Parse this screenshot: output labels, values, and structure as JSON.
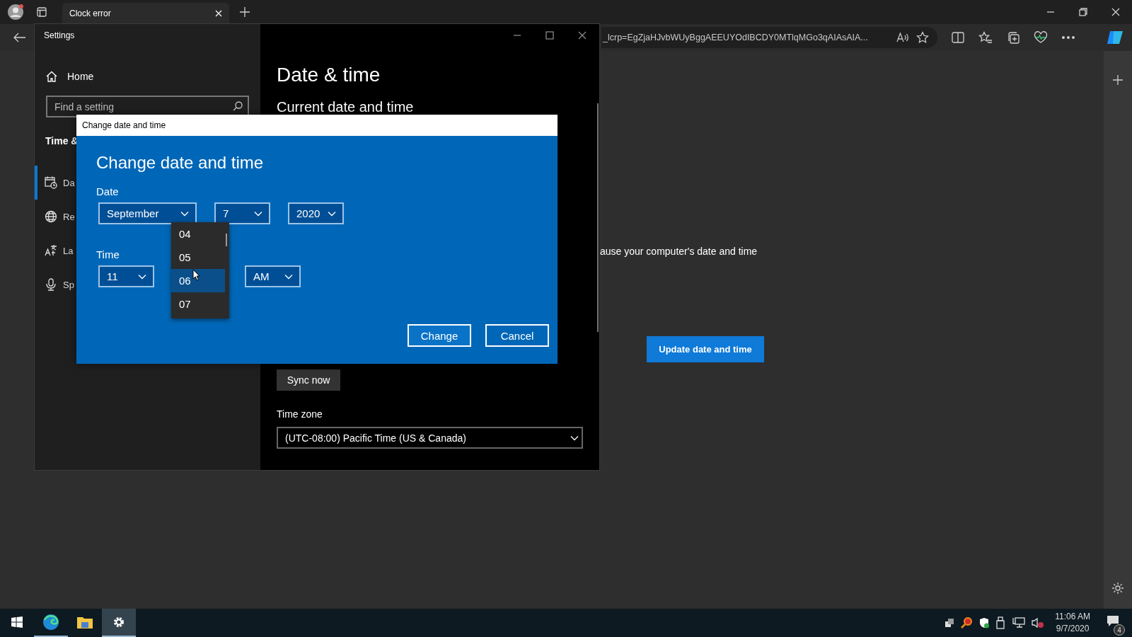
{
  "browser": {
    "tab": {
      "title": "Clock error"
    },
    "address": "_lcrp=EgZjaHJvbWUyBggAEEUYOdIBCDY0MTlqMGo3qAIAsAIA...",
    "page": {
      "text": "ause your computer's date and time",
      "button": "Update date and time"
    }
  },
  "settings": {
    "title": "Settings",
    "home": "Home",
    "search": {
      "placeholder": "Find a setting"
    },
    "section": "Time &",
    "nav": [
      {
        "label": "Da",
        "kind": "calendar",
        "selected": true
      },
      {
        "label": "Re",
        "kind": "globe",
        "selected": false
      },
      {
        "label": "La",
        "kind": "language",
        "selected": false
      },
      {
        "label": "Sp",
        "kind": "microphone",
        "selected": false
      }
    ],
    "heading": "Date & time",
    "subheading": "Current date and time",
    "sync_button": "Sync now",
    "time_zone": {
      "label": "Time zone",
      "value": "(UTC-08:00) Pacific Time (US & Canada)"
    }
  },
  "dialog": {
    "title": "Change date and time",
    "heading": "Change date and time",
    "date_label": "Date",
    "date": [
      "September",
      "7",
      "2020"
    ],
    "time_label": "Time",
    "time": [
      "11",
      "AM"
    ],
    "minutes": [
      {
        "label": "04",
        "selected": false
      },
      {
        "label": "05",
        "selected": false
      },
      {
        "label": "06",
        "selected": true
      },
      {
        "label": "07",
        "selected": false
      }
    ],
    "buttons": [
      "Change",
      "Cancel"
    ]
  },
  "taskbar": {
    "apps": [
      {
        "kind": "start",
        "running": false,
        "selected": false
      },
      {
        "kind": "browser",
        "running": true,
        "selected": false
      },
      {
        "kind": "folder",
        "running": false,
        "selected": false
      },
      {
        "kind": "settings",
        "running": true,
        "selected": true
      }
    ],
    "clock": {
      "time": "11:06 AM",
      "date": "9/7/2020"
    },
    "notifications": "4"
  }
}
